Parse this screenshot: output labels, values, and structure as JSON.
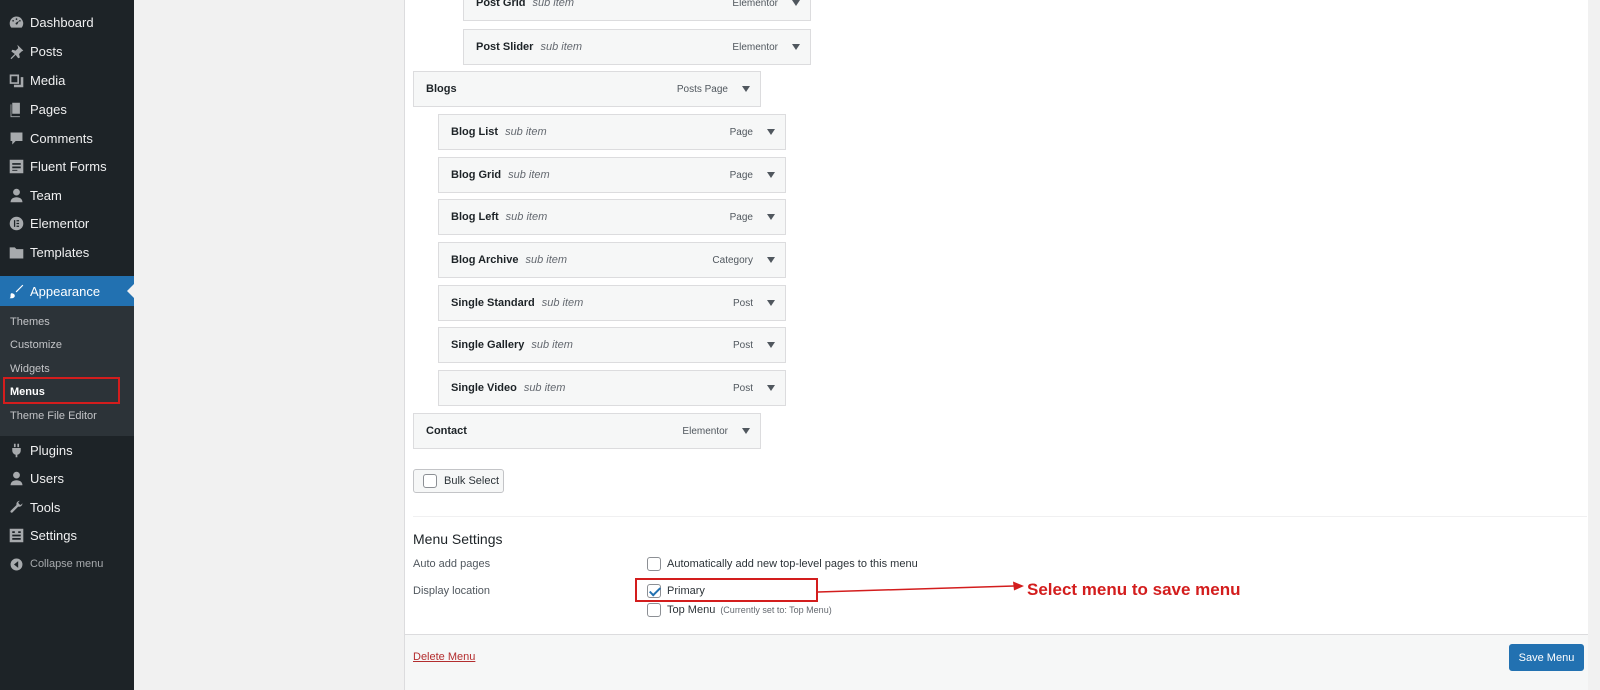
{
  "sidebar": {
    "items": [
      {
        "label": "Dashboard",
        "icon": "dashboard-icon"
      },
      {
        "label": "Posts",
        "icon": "pin-icon"
      },
      {
        "label": "Media",
        "icon": "media-icon"
      },
      {
        "label": "Pages",
        "icon": "pages-icon"
      },
      {
        "label": "Comments",
        "icon": "comment-icon"
      },
      {
        "label": "Fluent Forms",
        "icon": "forms-icon"
      },
      {
        "label": "Team",
        "icon": "person-icon"
      },
      {
        "label": "Elementor",
        "icon": "elementor-icon"
      },
      {
        "label": "Templates",
        "icon": "folder-icon"
      }
    ],
    "appearance": {
      "label": "Appearance",
      "icon": "brush-icon"
    },
    "submenu": [
      "Themes",
      "Customize",
      "Widgets",
      "Menus",
      "Theme File Editor"
    ],
    "items_after": [
      {
        "label": "Plugins",
        "icon": "plugin-icon"
      },
      {
        "label": "Users",
        "icon": "users-icon"
      },
      {
        "label": "Tools",
        "icon": "wrench-icon"
      },
      {
        "label": "Settings",
        "icon": "settings-icon"
      }
    ],
    "collapse_label": "Collapse menu"
  },
  "menu_items": [
    {
      "title": "Post Grid",
      "sub": "sub item",
      "type": "Elementor"
    },
    {
      "title": "Post Slider",
      "sub": "sub item",
      "type": "Elementor"
    },
    {
      "title": "Blogs",
      "sub": "",
      "type": "Posts Page"
    },
    {
      "title": "Blog List",
      "sub": "sub item",
      "type": "Page"
    },
    {
      "title": "Blog Grid",
      "sub": "sub item",
      "type": "Page"
    },
    {
      "title": "Blog Left",
      "sub": "sub item",
      "type": "Page"
    },
    {
      "title": "Blog Archive",
      "sub": "sub item",
      "type": "Category"
    },
    {
      "title": "Single Standard",
      "sub": "sub item",
      "type": "Post"
    },
    {
      "title": "Single Gallery",
      "sub": "sub item",
      "type": "Post"
    },
    {
      "title": "Single Video",
      "sub": "sub item",
      "type": "Post"
    },
    {
      "title": "Contact",
      "sub": "",
      "type": "Elementor"
    }
  ],
  "bulk_select_label": "Bulk Select",
  "menu_settings": {
    "heading": "Menu Settings",
    "auto_add_label": "Auto add pages",
    "auto_add_option": "Automatically add new top-level pages to this menu",
    "display_location_label": "Display location",
    "primary_label": "Primary",
    "top_menu_label": "Top Menu",
    "top_menu_hint": "(Currently set to: Top Menu)"
  },
  "delete_menu_label": "Delete Menu",
  "save_menu_label": "Save Menu",
  "annotation_text": "Select menu to save menu",
  "colors": {
    "accent": "#2271b1",
    "annotation": "#d31d1d",
    "sidebar": "#1d2327"
  }
}
